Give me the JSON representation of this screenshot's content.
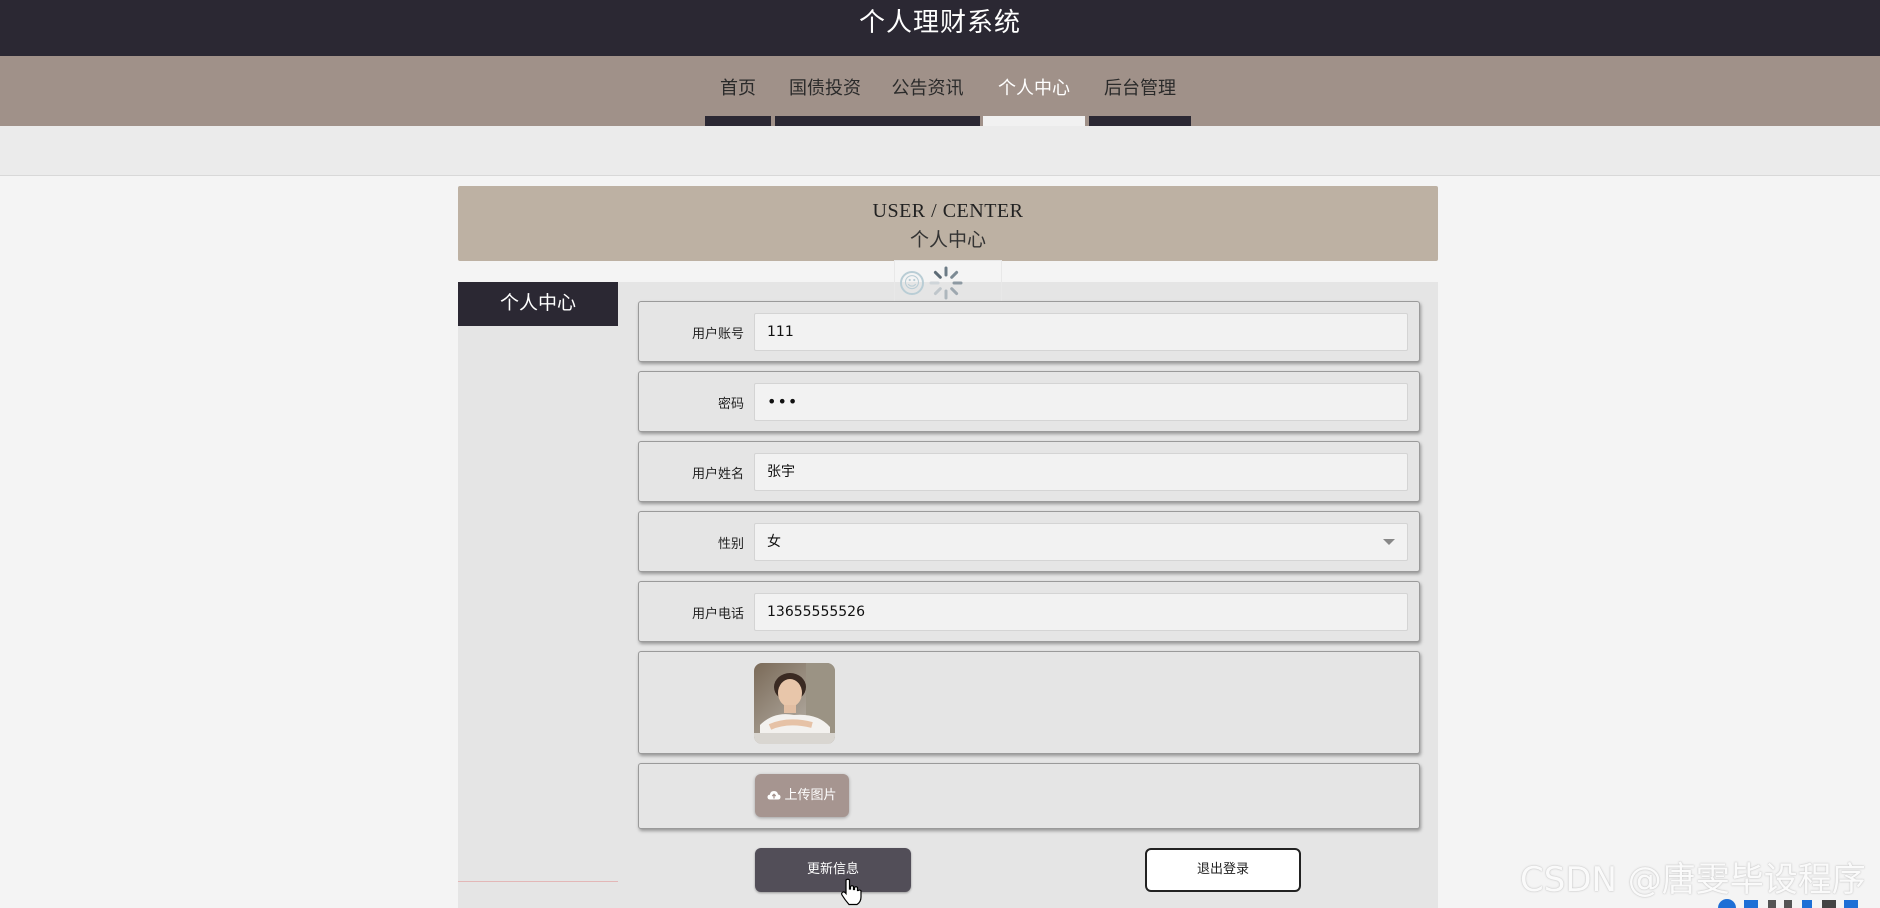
{
  "site": {
    "title": "个人理财系统"
  },
  "nav": {
    "items": [
      {
        "label": "首页",
        "active": false
      },
      {
        "label": "国债投资",
        "active": false
      },
      {
        "label": "公告资讯",
        "active": false
      },
      {
        "label": "个人中心",
        "active": true
      },
      {
        "label": "后台管理",
        "active": false
      }
    ]
  },
  "page_header": {
    "title_en": "USER / CENTER",
    "title_zh": "个人中心"
  },
  "sidebar": {
    "active_label": "个人中心"
  },
  "form": {
    "account": {
      "label": "用户账号",
      "value": "111"
    },
    "password": {
      "label": "密码",
      "value": "•••"
    },
    "name": {
      "label": "用户姓名",
      "value": "张宇"
    },
    "gender": {
      "label": "性别",
      "value": "女"
    },
    "phone": {
      "label": "用户电话",
      "value": "13655555526"
    },
    "upload_label": "上传图片"
  },
  "actions": {
    "update_label": "更新信息",
    "logout_label": "退出登录"
  },
  "watermark": "CSDN @唐雯毕设程序",
  "colors": {
    "dark": "#2b2833",
    "nav_bg": "#a09189",
    "header_bg": "#bdb1a3",
    "upload_btn": "#a69590",
    "update_btn": "#524e58"
  },
  "icons": [
    "emoji-icon",
    "loading-spinner-icon",
    "cloud-upload-icon",
    "select-caret-icon",
    "hand-cursor-icon"
  ]
}
